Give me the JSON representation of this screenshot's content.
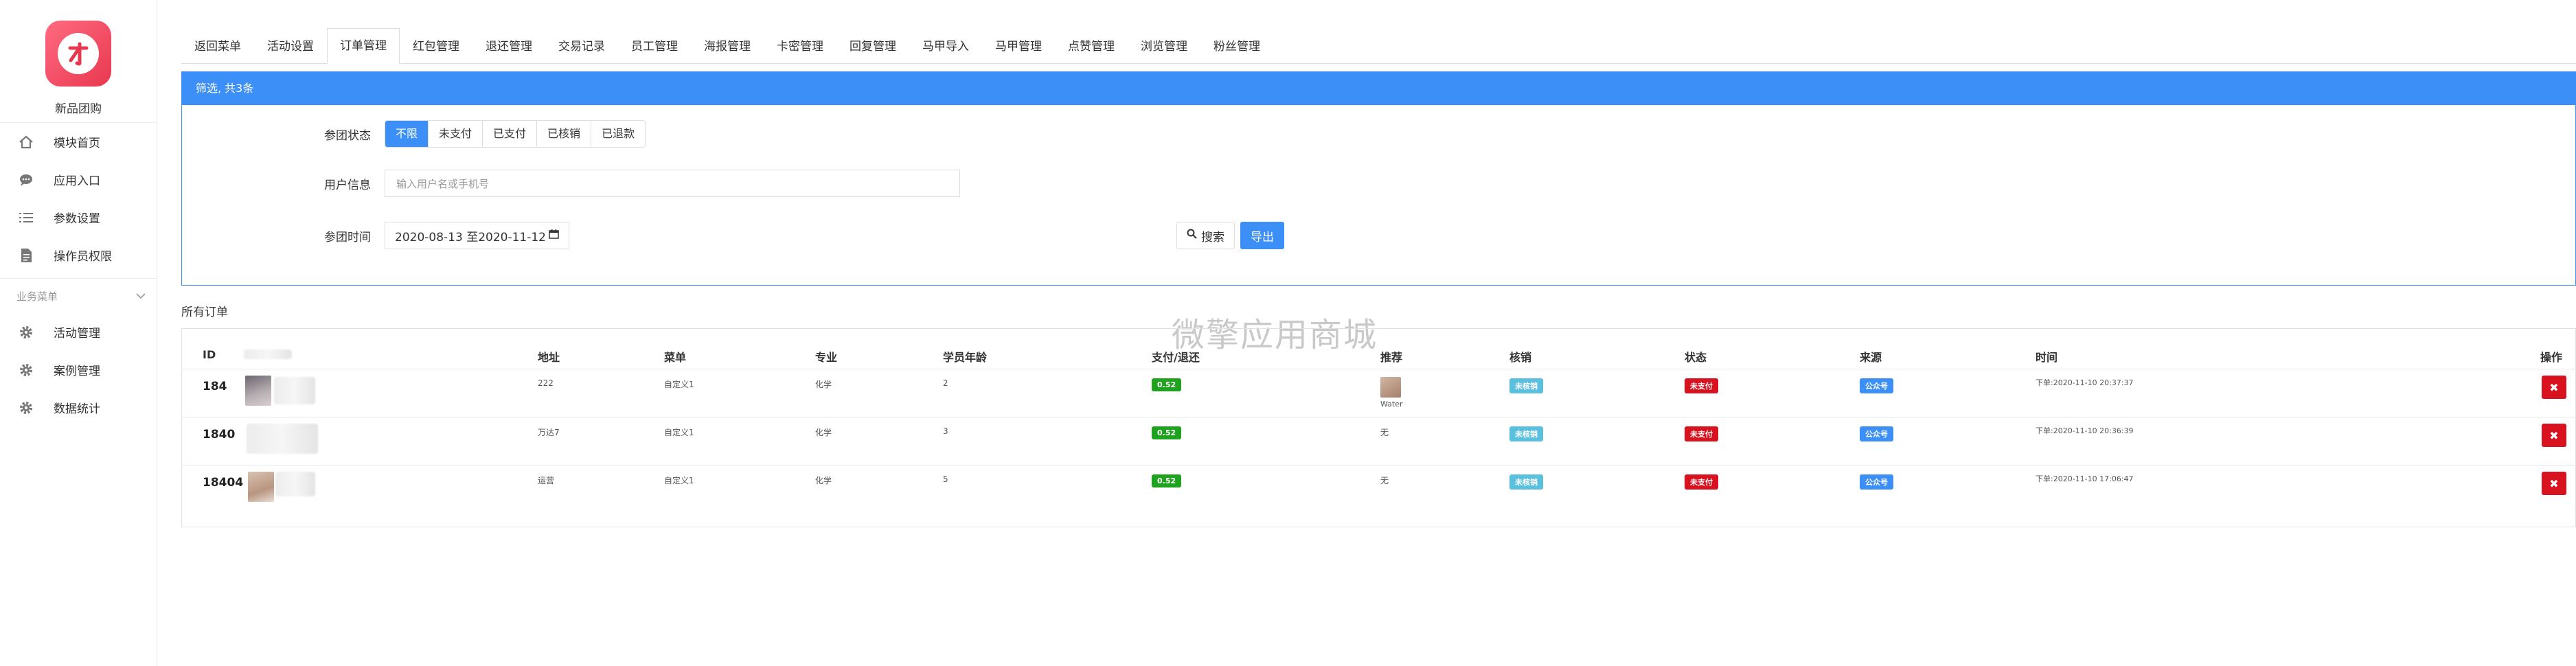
{
  "sidebar": {
    "brand_name": "新品团购",
    "items": [
      {
        "label": "模块首页",
        "icon": "home-icon"
      },
      {
        "label": "应用入口",
        "icon": "chat-icon"
      },
      {
        "label": "参数设置",
        "icon": "list-icon"
      },
      {
        "label": "操作员权限",
        "icon": "document-icon"
      }
    ],
    "section_label": "业务菜单",
    "section_items": [
      {
        "label": "活动管理",
        "icon": "gear-icon"
      },
      {
        "label": "案例管理",
        "icon": "gear-icon"
      },
      {
        "label": "数据统计",
        "icon": "gear-icon"
      }
    ]
  },
  "tabs": [
    "返回菜单",
    "活动设置",
    "订单管理",
    "红包管理",
    "退还管理",
    "交易记录",
    "员工管理",
    "海报管理",
    "卡密管理",
    "回复管理",
    "马甲导入",
    "马甲管理",
    "点赞管理",
    "浏览管理",
    "粉丝管理"
  ],
  "active_tab": "订单管理",
  "filter": {
    "header": "筛选, 共3条",
    "status_label": "参团状态",
    "status_options": [
      "不限",
      "未支付",
      "已支付",
      "已核销",
      "已退款"
    ],
    "status_selected": "不限",
    "user_label": "用户信息",
    "user_placeholder": "输入用户名或手机号",
    "time_label": "参团时间",
    "date_range": "2020-08-13 至2020-11-12",
    "search_label": "搜索",
    "export_label": "导出"
  },
  "orders": {
    "title": "所有订单",
    "watermark": "微擎应用商城",
    "columns": [
      "ID",
      "地址",
      "菜单",
      "专业",
      "学员年龄",
      "支付/退还",
      "推荐",
      "核销",
      "状态",
      "来源",
      "时间",
      "操作"
    ],
    "rows": [
      {
        "id": "184",
        "address": "222",
        "menu": "自定义1",
        "major": "化学",
        "age": "2",
        "pay": "0.52",
        "recommend": "Water",
        "verify": "未核销",
        "status": "未支付",
        "source": "公众号",
        "time": "下单:2020-11-10 20:37:37"
      },
      {
        "id": "1840",
        "address": "万达7",
        "menu": "自定义1",
        "major": "化学",
        "age": "3",
        "pay": "0.52",
        "recommend": "无",
        "verify": "未核销",
        "status": "未支付",
        "source": "公众号",
        "time": "下单:2020-11-10 20:36:39"
      },
      {
        "id": "18404",
        "address": "运营",
        "menu": "自定义1",
        "major": "化学",
        "age": "5",
        "pay": "0.52",
        "recommend": "无",
        "verify": "未核销",
        "status": "未支付",
        "source": "公众号",
        "time": "下单:2020-11-10 17:06:47"
      }
    ]
  },
  "colors": {
    "primary": "#3b8ff7",
    "success": "#1fa31f",
    "info": "#5bc0de",
    "danger": "#d9121f"
  }
}
